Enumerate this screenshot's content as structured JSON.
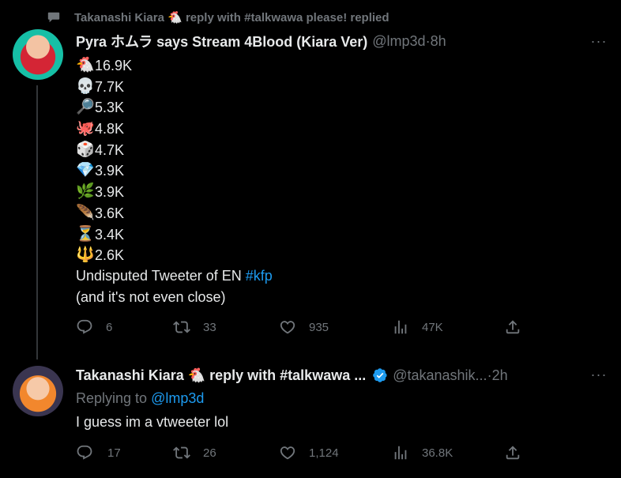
{
  "social_context": {
    "icon": "speech-bubble-icon",
    "text": "Takanashi Kiara 🐔 reply with #talkwawa please! replied"
  },
  "tweets": [
    {
      "display_name": "Pyra ホムラ says Stream 4Blood (Kiara Ver)",
      "handle": "@lmp3d",
      "time": "8h",
      "stats": [
        {
          "emoji": "🐔",
          "value": "16.9K"
        },
        {
          "emoji": "💀",
          "value": "7.7K"
        },
        {
          "emoji": "🔎",
          "value": "5.3K"
        },
        {
          "emoji": "🐙",
          "value": "4.8K"
        },
        {
          "emoji": "🎲",
          "value": "4.7K"
        },
        {
          "emoji": "💎",
          "value": "3.9K"
        },
        {
          "emoji": "🌿",
          "value": "3.9K"
        },
        {
          "emoji": "🪶",
          "value": "3.6K"
        },
        {
          "emoji": "⏳",
          "value": "3.4K"
        },
        {
          "emoji": "🔱",
          "value": "2.6K"
        }
      ],
      "text_line1": "Undisputed Tweeter of EN ",
      "hashtag": "#kfp",
      "text_line2": "(and it's not even close)",
      "replies": "6",
      "retweets": "33",
      "likes": "935",
      "views": "47K"
    },
    {
      "display_name": "Takanashi Kiara 🐔 reply with #talkwawa ...",
      "handle": "@takanashik...",
      "time": "2h",
      "replying_prefix": "Replying to ",
      "replying_to": "@lmp3d",
      "text": "I guess im a vtweeter lol",
      "replies": "17",
      "retweets": "26",
      "likes": "1,124",
      "views": "36.8K"
    }
  ],
  "more_label": "···",
  "dot_sep": " · ",
  "colors": {
    "background": "#000000",
    "text": "#e7e9ea",
    "secondary": "#71767b",
    "accent": "#1d9bf0"
  }
}
